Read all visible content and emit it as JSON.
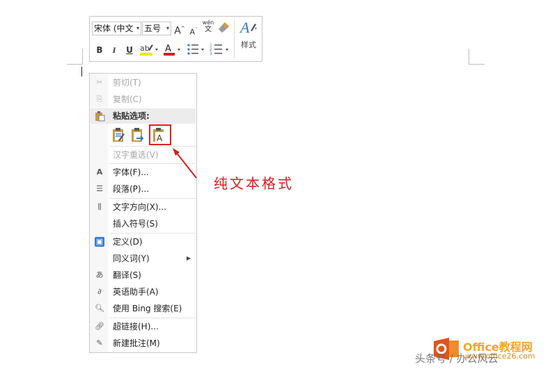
{
  "toolbar": {
    "font_name": "宋体 (中文",
    "font_size": "五号",
    "grow_font": "A",
    "shrink_font": "A",
    "phonetic_top": "wén",
    "phonetic_bottom": "文",
    "bold": "B",
    "italic": "I",
    "underline": "U",
    "font_color": "A",
    "styles_label": "样式",
    "highlight_color": "#f2e600",
    "font_color_bar": "#d21f1f"
  },
  "menu": {
    "cut": "剪切(T)",
    "copy": "复制(C)",
    "paste_options": "粘贴选项:",
    "reconvert": "汉字重选(V)",
    "font": "字体(F)...",
    "paragraph": "段落(P)...",
    "text_direction": "文字方向(X)...",
    "insert_symbol": "插入符号(S)",
    "define": "定义(D)",
    "synonyms": "同义词(Y)",
    "translate": "翻译(S)",
    "english_assistant": "英语助手(A)",
    "bing_search": "使用 Bing 搜索(E)",
    "hyperlink": "超链接(H)...",
    "new_comment": "新建批注(M)"
  },
  "annotation": {
    "text": "纯文本格式",
    "color": "#d21f1f"
  },
  "watermark": {
    "title": "Office教程网",
    "url": "www.office26.com",
    "overlay": "头条号 / 办公风云"
  }
}
